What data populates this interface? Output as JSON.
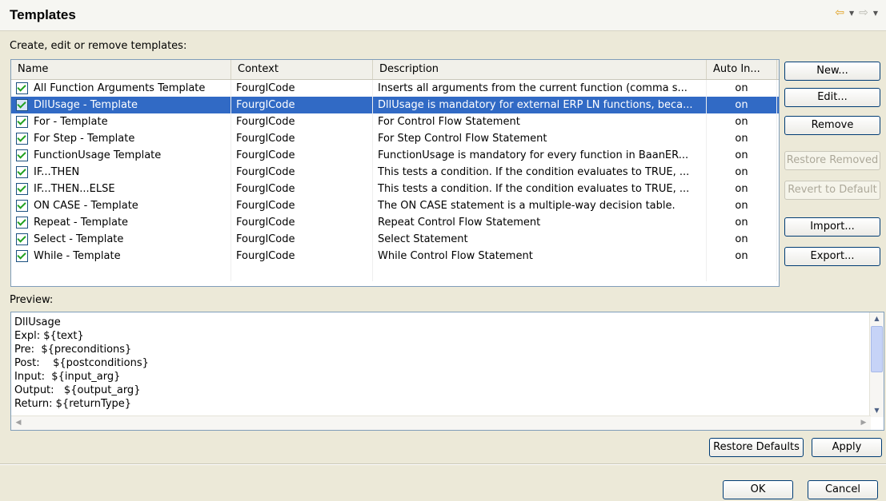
{
  "header": {
    "title": "Templates",
    "back_icon": "nav-back-arrow",
    "forward_icon": "nav-forward-arrow"
  },
  "subtitle": "Create, edit or remove templates:",
  "table": {
    "columns": [
      "Name",
      "Context",
      "Description",
      "Auto In..."
    ],
    "rows": [
      {
        "name": "All Function Arguments Template",
        "context": "FourglCode",
        "description": "Inserts all arguments from the current function (comma s...",
        "auto": "on",
        "selected": false
      },
      {
        "name": "DllUsage - Template",
        "context": "FourglCode",
        "description": "DllUsage is mandatory for external ERP LN functions, beca...",
        "auto": "on",
        "selected": true
      },
      {
        "name": "For - Template",
        "context": "FourglCode",
        "description": "For Control Flow Statement",
        "auto": "on",
        "selected": false
      },
      {
        "name": "For Step - Template",
        "context": "FourglCode",
        "description": "For Step Control Flow Statement",
        "auto": "on",
        "selected": false
      },
      {
        "name": "FunctionUsage Template",
        "context": "FourglCode",
        "description": "FunctionUsage is mandatory for every function in BaanER...",
        "auto": "on",
        "selected": false
      },
      {
        "name": "IF...THEN",
        "context": "FourglCode",
        "description": "This tests a condition. If the condition evaluates to TRUE, ...",
        "auto": "on",
        "selected": false
      },
      {
        "name": "IF...THEN...ELSE",
        "context": "FourglCode",
        "description": "This tests a condition. If the condition evaluates to TRUE, ...",
        "auto": "on",
        "selected": false
      },
      {
        "name": "ON CASE - Template",
        "context": "FourglCode",
        "description": "The ON CASE statement is a multiple-way decision table.",
        "auto": "on",
        "selected": false
      },
      {
        "name": "Repeat - Template",
        "context": "FourglCode",
        "description": "Repeat Control Flow Statement",
        "auto": "on",
        "selected": false
      },
      {
        "name": "Select - Template",
        "context": "FourglCode",
        "description": "Select Statement",
        "auto": "on",
        "selected": false
      },
      {
        "name": "While - Template",
        "context": "FourglCode",
        "description": "While Control Flow Statement",
        "auto": "on",
        "selected": false
      }
    ]
  },
  "buttons": {
    "new": "New...",
    "edit": "Edit...",
    "remove": "Remove",
    "restore_removed": "Restore Removed",
    "revert_default": "Revert to Default",
    "import": "Import...",
    "export": "Export...",
    "restore_defaults": "Restore Defaults",
    "apply": "Apply",
    "ok": "OK",
    "cancel": "Cancel"
  },
  "preview": {
    "label": "Preview:",
    "text": "DllUsage\nExpl: ${text}\nPre:  ${preconditions}\nPost:    ${postconditions}\nInput:  ${input_arg}\nOutput:   ${output_arg}\nReturn: ${returnType}"
  },
  "colors": {
    "selection": "#316AC5",
    "background": "#ECE9D8",
    "border": "#7F9DB9"
  }
}
